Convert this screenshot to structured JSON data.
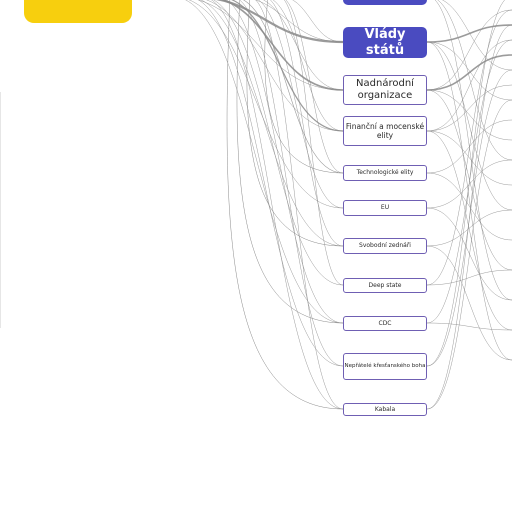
{
  "nodes": [
    {
      "label": ""
    },
    {
      "label": "Vlády států"
    },
    {
      "label": "Nadnárodní organizace"
    },
    {
      "label": "Finanční a mocenské elity"
    },
    {
      "label": "Technologické elity"
    },
    {
      "label": "EU"
    },
    {
      "label": "Svobodní zednáři"
    },
    {
      "label": "Deep state"
    },
    {
      "label": "CDC"
    },
    {
      "label": "Nepřátelé křesťanského boha"
    },
    {
      "label": "Kabala"
    }
  ],
  "colors": {
    "accent_node": "#4a4bc0",
    "yellow": "#f7cf0e",
    "node_border": "#6f5fb3",
    "links": "#8a8a8a"
  }
}
